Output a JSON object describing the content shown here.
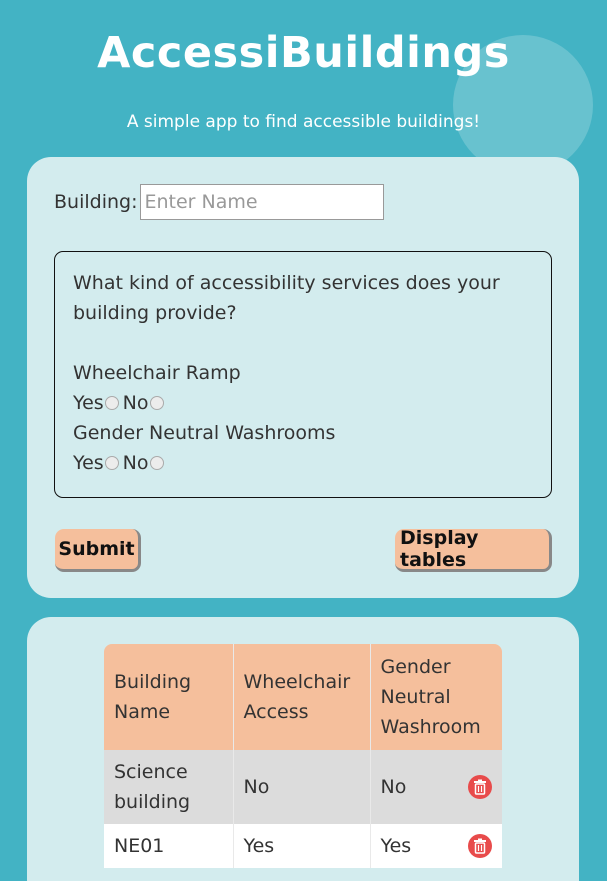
{
  "app": {
    "title": "AccessiBuildings",
    "subtitle": "A simple app to find accessible buildings!"
  },
  "form": {
    "building_label": "Building:",
    "building_input_value": "",
    "building_placeholder": "Enter Name",
    "question": "What kind of accessibility services does your building provide?",
    "services": [
      {
        "name": "Wheelchair Ramp",
        "yes_label": "Yes",
        "no_label": "No",
        "selected": null
      },
      {
        "name": "Gender Neutral Washrooms",
        "yes_label": "Yes",
        "no_label": "No",
        "selected": null
      }
    ],
    "submit_label": "Submit",
    "display_tables_label": "Display tables"
  },
  "table": {
    "headers": [
      "Building Name",
      "Wheelchair Access",
      "Gender Neutral Washroom"
    ],
    "rows": [
      {
        "building": "Science building",
        "wheelchair": "No",
        "washroom": "No",
        "delete_icon": "trash-icon"
      },
      {
        "building": "NE01",
        "wheelchair": "Yes",
        "washroom": "Yes",
        "delete_icon": "trash-icon"
      }
    ]
  },
  "colors": {
    "background": "#43b3c4",
    "card": "#d3ecee",
    "accent": "#f5bf9c",
    "delete": "#e84b4b"
  }
}
